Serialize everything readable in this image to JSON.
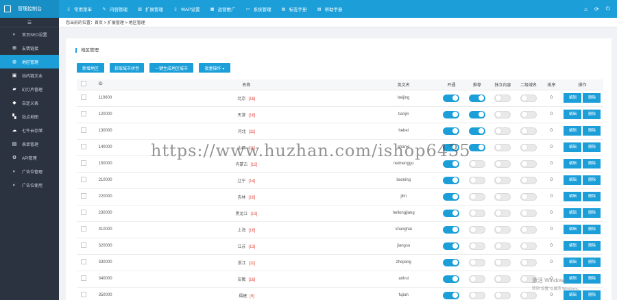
{
  "topbar": {
    "brand": "管理控制台",
    "nav": [
      {
        "icon": "document-icon",
        "glyph": "▯",
        "label": "常用菜单"
      },
      {
        "icon": "edit-icon",
        "glyph": "✎",
        "label": "内容管理"
      },
      {
        "icon": "chart-icon",
        "glyph": "▥",
        "label": "扩展管理"
      },
      {
        "icon": "mobile-icon",
        "glyph": "▯",
        "label": "WAP设置"
      },
      {
        "icon": "grid-icon",
        "glyph": "▦",
        "label": "运营推广"
      },
      {
        "icon": "monitor-icon",
        "glyph": "▭",
        "label": "系统管理"
      },
      {
        "icon": "book-icon",
        "glyph": "▤",
        "label": "标签手册"
      },
      {
        "icon": "help-icon",
        "glyph": "▤",
        "label": "帮助手册"
      }
    ],
    "right_icons": [
      "home-icon",
      "refresh-icon",
      "power-icon"
    ]
  },
  "sidebar": {
    "toggle_glyph": "☰",
    "items": [
      {
        "icon": "half-circle-icon",
        "glyph": "◐",
        "label": "首页SEO设置"
      },
      {
        "icon": "sitemap-icon",
        "glyph": "⊞",
        "label": "友情链接"
      },
      {
        "icon": "globe-icon",
        "glyph": "◍",
        "label": "地区管理",
        "active": true
      },
      {
        "icon": "image-icon",
        "glyph": "▣",
        "label": "站内链文本"
      },
      {
        "icon": "ad-icon",
        "glyph": "▰",
        "label": "幻灯片管理"
      },
      {
        "icon": "tag-icon",
        "glyph": "◆",
        "label": "自定义表"
      },
      {
        "icon": "map-icon",
        "glyph": "▚",
        "label": "站点地图"
      },
      {
        "icon": "cloud-icon",
        "glyph": "☁",
        "label": "七牛云存储"
      },
      {
        "icon": "form-icon",
        "glyph": "▤",
        "label": "表单管理"
      },
      {
        "icon": "api-icon",
        "glyph": "⚙",
        "label": "API管理"
      },
      {
        "icon": "half-circle-icon",
        "glyph": "◐",
        "label": "广告位管理"
      },
      {
        "icon": "half-circle-icon",
        "glyph": "◐",
        "label": "广告位使用"
      }
    ]
  },
  "breadcrumb": "您当前的位置：首页 > 扩展管理 > 地区管理",
  "panel": {
    "title": "地区管理",
    "buttons": {
      "add": "新增地区",
      "pinyin": "获取城市拼音",
      "generate": "一键生成地区城市",
      "batch": "批量操作 ▾"
    }
  },
  "table": {
    "headers": {
      "id": "ID",
      "name": "名称",
      "pinyin": "英文名",
      "open": "开通",
      "recommend": "推荐",
      "independent": "独立内容",
      "second": "二级域名",
      "sort": "排序",
      "op": "操作"
    },
    "edit_label": "编辑",
    "delete_label": "删除",
    "rows": [
      {
        "id": "110000",
        "name": "北京",
        "count": "[16]",
        "pinyin": "beijing",
        "open": true,
        "recommend": true,
        "independent": false,
        "second": false,
        "sort": "0"
      },
      {
        "id": "120000",
        "name": "天津",
        "count": "[16]",
        "pinyin": "tianjin",
        "open": true,
        "recommend": true,
        "independent": false,
        "second": false,
        "sort": "0"
      },
      {
        "id": "130000",
        "name": "河北",
        "count": "[11]",
        "pinyin": "hebei",
        "open": true,
        "recommend": true,
        "independent": false,
        "second": false,
        "sort": "0"
      },
      {
        "id": "140000",
        "name": "山西",
        "count": "[11]",
        "pinyin": "shanxi",
        "open": true,
        "recommend": true,
        "independent": false,
        "second": false,
        "sort": "0"
      },
      {
        "id": "150000",
        "name": "内蒙古",
        "count": "[12]",
        "pinyin": "neimenggu",
        "open": true,
        "recommend": false,
        "independent": false,
        "second": false,
        "sort": "0"
      },
      {
        "id": "210000",
        "name": "辽宁",
        "count": "[14]",
        "pinyin": "liaoning",
        "open": true,
        "recommend": false,
        "independent": false,
        "second": false,
        "sort": "0"
      },
      {
        "id": "220000",
        "name": "吉林",
        "count": "[16]",
        "pinyin": "jilin",
        "open": true,
        "recommend": false,
        "independent": false,
        "second": false,
        "sort": "0"
      },
      {
        "id": "230000",
        "name": "黑龙江",
        "count": "[13]",
        "pinyin": "heilongjiang",
        "open": true,
        "recommend": false,
        "independent": false,
        "second": false,
        "sort": "0"
      },
      {
        "id": "310000",
        "name": "上海",
        "count": "[16]",
        "pinyin": "shanghai",
        "open": true,
        "recommend": false,
        "independent": false,
        "second": false,
        "sort": "0"
      },
      {
        "id": "320000",
        "name": "江苏",
        "count": "[13]",
        "pinyin": "jiangsu",
        "open": true,
        "recommend": false,
        "independent": false,
        "second": false,
        "sort": "0"
      },
      {
        "id": "330000",
        "name": "浙江",
        "count": "[11]",
        "pinyin": "zhejiang",
        "open": true,
        "recommend": false,
        "independent": false,
        "second": false,
        "sort": "0"
      },
      {
        "id": "340000",
        "name": "安徽",
        "count": "[16]",
        "pinyin": "anhui",
        "open": true,
        "recommend": false,
        "independent": false,
        "second": false,
        "sort": "0"
      },
      {
        "id": "350000",
        "name": "福建",
        "count": "[9]",
        "pinyin": "fujian",
        "open": true,
        "recommend": false,
        "independent": false,
        "second": false,
        "sort": "0"
      }
    ]
  },
  "overlay": {
    "watermark": "https://www.huzhan.com/ishop6435",
    "activate_title": "激活 Windows",
    "activate_sub": "转到\"设置\"以激活 Windows。"
  },
  "colors": {
    "accent": "#1c9fd9",
    "sidebar": "#2b3240",
    "count": "#e0463c"
  }
}
